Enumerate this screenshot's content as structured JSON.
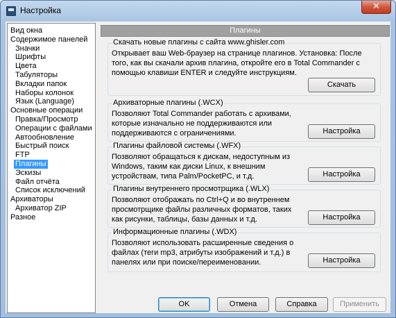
{
  "window": {
    "title": "Настройка",
    "close_glyph": "✕"
  },
  "tree": {
    "items": [
      {
        "label": "Вид окна",
        "level": 0,
        "selected": false
      },
      {
        "label": "Содержимое панелей",
        "level": 0,
        "selected": false
      },
      {
        "label": "Значки",
        "level": 1,
        "selected": false
      },
      {
        "label": "Шрифты",
        "level": 1,
        "selected": false
      },
      {
        "label": "Цвета",
        "level": 1,
        "selected": false
      },
      {
        "label": "Табуляторы",
        "level": 1,
        "selected": false
      },
      {
        "label": "Вкладки папок",
        "level": 1,
        "selected": false
      },
      {
        "label": "Наборы колонок",
        "level": 1,
        "selected": false
      },
      {
        "label": "Язык (Language)",
        "level": 1,
        "selected": false
      },
      {
        "label": "Основные операции",
        "level": 0,
        "selected": false
      },
      {
        "label": "Правка/Просмотр",
        "level": 1,
        "selected": false
      },
      {
        "label": "Операции с файлами",
        "level": 1,
        "selected": false
      },
      {
        "label": "Автообновление",
        "level": 1,
        "selected": false
      },
      {
        "label": "Быстрый поиск",
        "level": 1,
        "selected": false
      },
      {
        "label": "FTP",
        "level": 1,
        "selected": false
      },
      {
        "label": "Плагины",
        "level": 1,
        "selected": true
      },
      {
        "label": "Эскизы",
        "level": 1,
        "selected": false
      },
      {
        "label": "Файл отчёта",
        "level": 1,
        "selected": false
      },
      {
        "label": "Список исключений",
        "level": 1,
        "selected": false
      },
      {
        "label": "Архиваторы",
        "level": 0,
        "selected": false
      },
      {
        "label": "Архиватор ZIP",
        "level": 1,
        "selected": false
      },
      {
        "label": "Разное",
        "level": 0,
        "selected": false
      }
    ]
  },
  "panel": {
    "header": "Плагины",
    "groups": [
      {
        "title": "Скачать новые плагины с сайта www.ghisler.com",
        "desc": [
          "Открывает ваш Web-браузер на странице плагинов. Установка: После",
          "того, как вы скачали архив плагина, откройте его в Total Commander с",
          "помощью клавиши ENTER и следуйте инструкциям."
        ],
        "button": "Скачать"
      },
      {
        "title": "Архиваторные плагины (.WCX)",
        "desc": [
          "Позволяют Total Commander работать с архивами,",
          "которые изначально не поддерживаются или",
          "поддерживаются с ограничениями."
        ],
        "button": "Настройка"
      },
      {
        "title": "Плагины файловой системы (.WFX)",
        "desc": [
          "Позволяют обращаться к дискам, недоступным из",
          "Windows, таким как диски Linux, к внешним",
          "устройствам, типа Palm/PocketPC, и т.д."
        ],
        "button": "Настройка"
      },
      {
        "title": "Плагины внутреннего просмотрщика (.WLX)",
        "desc": [
          "Позволяют отображать по Ctrl+Q и во внутреннем",
          "просмотрщике файлы различных форматов, таких",
          "как рисунки, таблицы, базы данных и т.д."
        ],
        "button": "Настройка"
      },
      {
        "title": "Информационные плагины (.WDX)",
        "desc": [
          "Позволяют использовать расширенные сведения о",
          "файлах (теги mp3, атрибуты изображений и т.д.) в",
          "панелях или при поиске/переименовании."
        ],
        "button": "Настройка"
      }
    ]
  },
  "footer": {
    "ok": "OK",
    "cancel": "Отмена",
    "help": "Справка",
    "apply": "Применить"
  }
}
